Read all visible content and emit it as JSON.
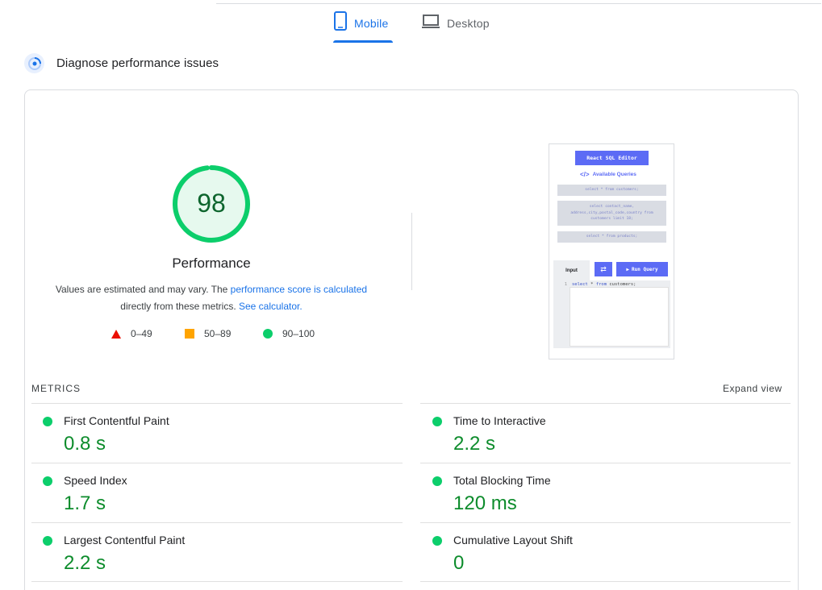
{
  "tabs": [
    {
      "label": "Mobile",
      "icon": "phone-icon",
      "active": true
    },
    {
      "label": "Desktop",
      "icon": "laptop-icon",
      "active": false
    }
  ],
  "diagnose": {
    "title": "Diagnose performance issues"
  },
  "performance": {
    "score": "98",
    "score_fraction": 0.98,
    "title": "Performance",
    "desc_prefix": "Values are estimated and may vary. The ",
    "desc_link1": "performance score is calculated",
    "desc_middle": "directly from these metrics. ",
    "desc_link2": "See calculator.",
    "legend": [
      {
        "range": "0–49",
        "shape": "triangle",
        "color": "#eb0f00"
      },
      {
        "range": "50–89",
        "shape": "square",
        "color": "#ffa400"
      },
      {
        "range": "90–100",
        "shape": "circle",
        "color": "#0cce6b"
      }
    ]
  },
  "screenshot": {
    "app_title": "React SQL Editor",
    "section": "Available Queries",
    "queries": [
      "select * from customers;",
      "select contact_name, address,city,postal_code,country from customers limit 18;",
      "select * from products;"
    ],
    "input_tab": "Input",
    "run_button": "Run Query",
    "editor_line_no": "1",
    "editor_code_kw1": "select",
    "editor_code_mid": " * ",
    "editor_code_kw2": "from",
    "editor_code_end": " customers;"
  },
  "metrics": {
    "title": "METRICS",
    "expand_label": "Expand view",
    "items": [
      {
        "label": "First Contentful Paint",
        "value": "0.8 s"
      },
      {
        "label": "Time to Interactive",
        "value": "2.2 s"
      },
      {
        "label": "Speed Index",
        "value": "1.7 s"
      },
      {
        "label": "Total Blocking Time",
        "value": "120 ms"
      },
      {
        "label": "Largest Contentful Paint",
        "value": "2.2 s"
      },
      {
        "label": "Cumulative Layout Shift",
        "value": "0"
      }
    ]
  },
  "colors": {
    "accent": "#1a73e8",
    "pass": "#0cce6b",
    "pass_text": "#0d8c2c"
  }
}
